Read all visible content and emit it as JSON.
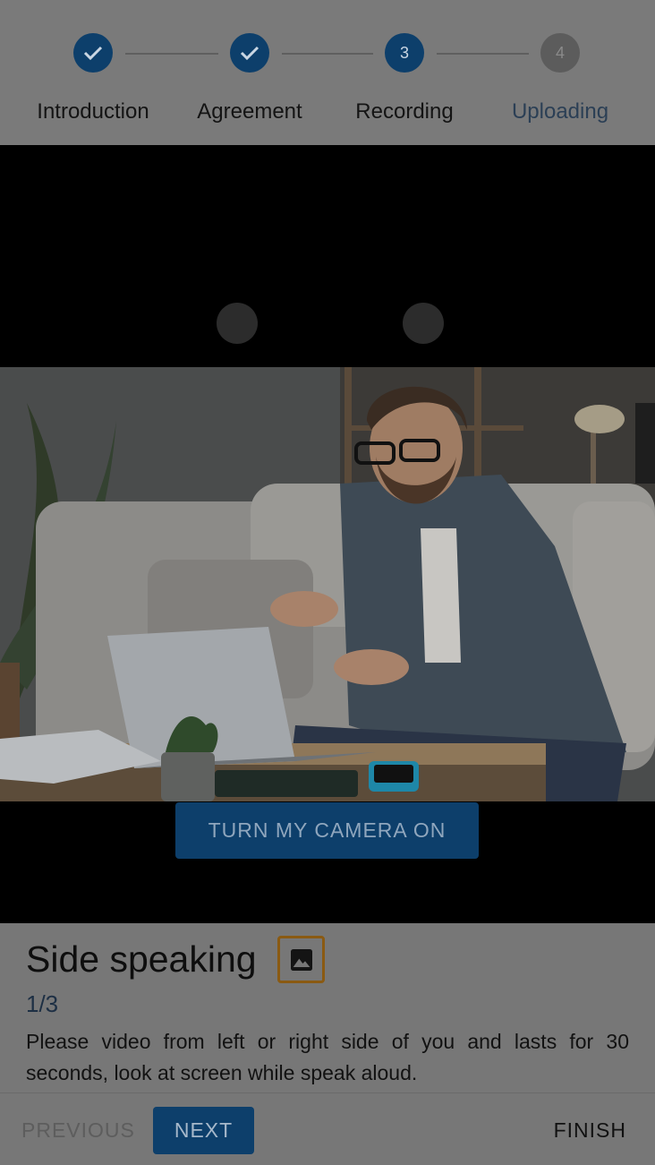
{
  "stepper": {
    "steps": [
      {
        "label": "Introduction",
        "state": "done",
        "number": "1"
      },
      {
        "label": "Agreement",
        "state": "done",
        "number": "2"
      },
      {
        "label": "Recording",
        "state": "active",
        "number": "3"
      },
      {
        "label": "Uploading",
        "state": "pending",
        "number": "4"
      }
    ]
  },
  "video": {
    "camera_button_label": "TURN MY CAMERA ON"
  },
  "prompt": {
    "title": "Side speaking",
    "image_icon": "image-icon",
    "progress": "1/3",
    "description": "Please video from left or right side of you and lasts for 30 seconds, look at screen while speak aloud."
  },
  "footer": {
    "previous_label": "PREVIOUS",
    "next_label": "NEXT",
    "finish_label": "FINISH"
  },
  "colors": {
    "primary": "#0d3f6b",
    "step_pending": "#5c5c5c",
    "image_button_border": "#8a5a12"
  }
}
